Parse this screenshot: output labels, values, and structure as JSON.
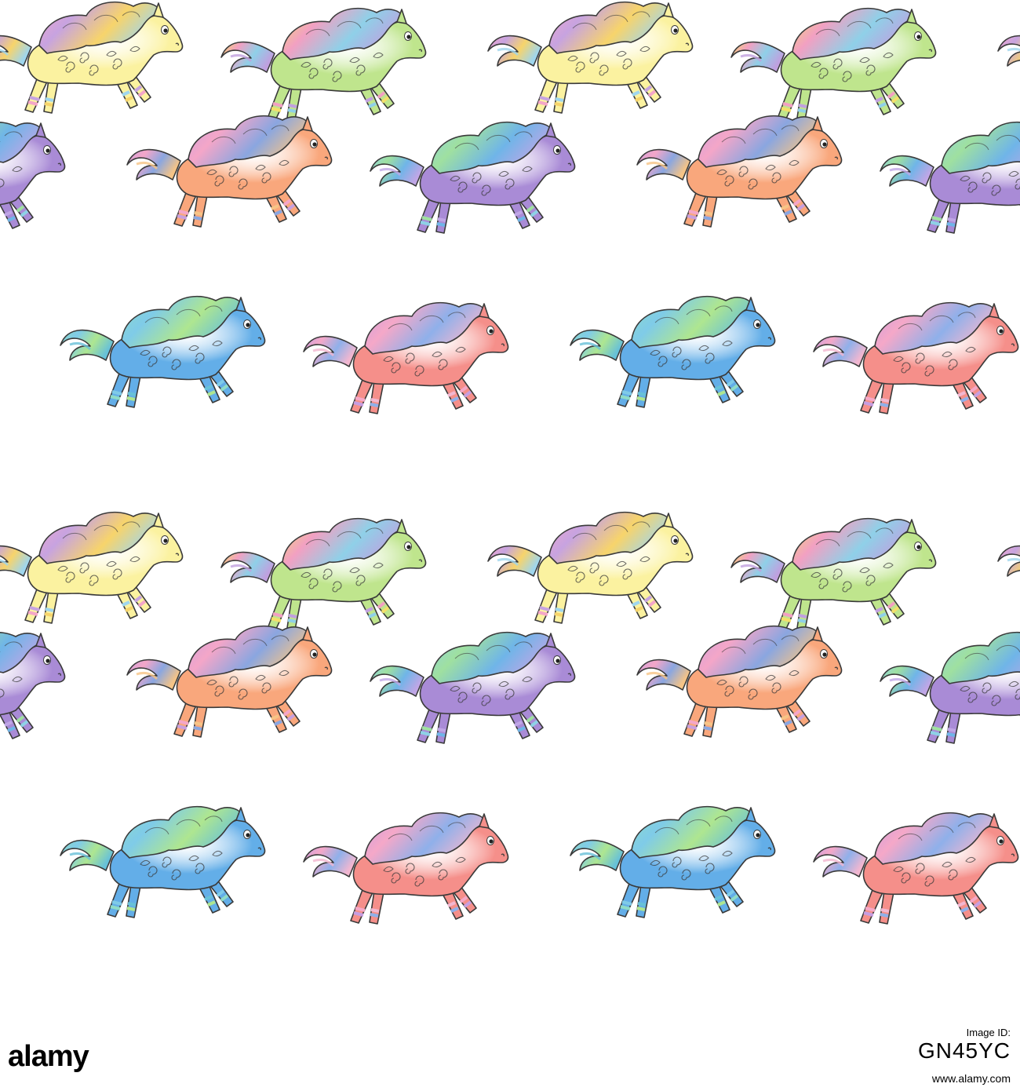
{
  "footer": {
    "brand": "alamy",
    "id_label": "Image ID:",
    "id_value": "GN45YC",
    "url": "www.alamy.com"
  },
  "pattern": {
    "background": "#ffffff",
    "outline": "#3a3a3a",
    "horse_palettes": {
      "yellow": {
        "body": "#fbf2a0",
        "mane": [
          "#f4a6c8",
          "#c7a3e0",
          "#f7d46b",
          "#9fd6ee"
        ]
      },
      "green": {
        "body": "#bfe58d",
        "mane": [
          "#f4e06a",
          "#f2a0c2",
          "#8fd0e8",
          "#c0a0df"
        ]
      },
      "orange": {
        "body": "#f9a77c",
        "mane": [
          "#c8a0de",
          "#f4a6c8",
          "#8aa6e0",
          "#f6c486"
        ]
      },
      "purple": {
        "body": "#a98bd6",
        "mane": [
          "#8ed2e6",
          "#9fe0a0",
          "#6fb5e8",
          "#c0a6e6"
        ]
      },
      "blue": {
        "body": "#63aee8",
        "mane": [
          "#8fdcc6",
          "#7fcbe8",
          "#aee690",
          "#68c1d8"
        ]
      },
      "pink": {
        "body": "#f58f8a",
        "mane": [
          "#c69ee0",
          "#f5a8c8",
          "#8fb0ea",
          "#f2b7d0"
        ]
      }
    },
    "rows": [
      [
        "yellow",
        "green"
      ],
      [
        "orange",
        "purple"
      ],
      [
        "blue",
        "pink"
      ]
    ]
  }
}
